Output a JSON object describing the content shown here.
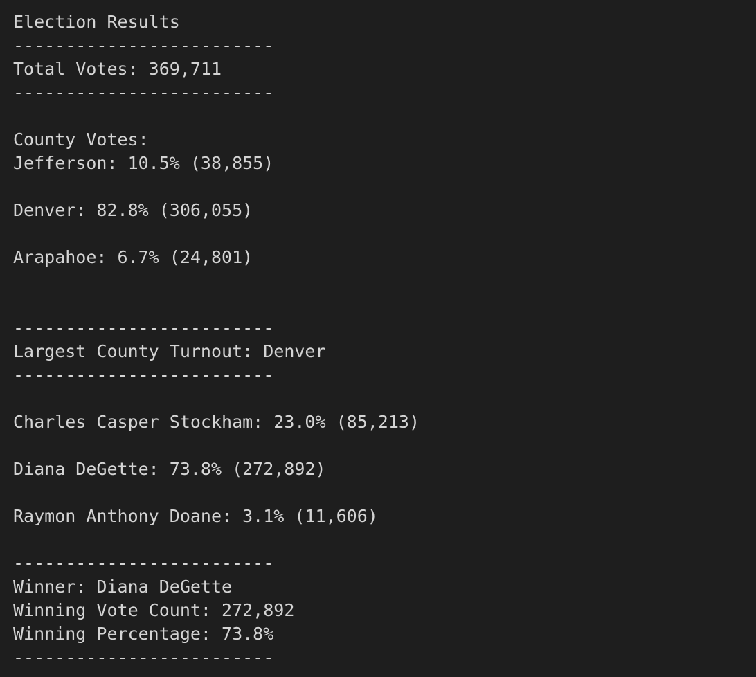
{
  "output": {
    "title": "Election Results",
    "separator": "-------------------------",
    "total_votes": "Total Votes: 369,711",
    "county_header": "County Votes:",
    "counties": [
      "Jefferson: 10.5% (38,855)",
      "Denver: 82.8% (306,055)",
      "Arapahoe: 6.7% (24,801)"
    ],
    "largest_county": "Largest County Turnout: Denver",
    "candidates": [
      "Charles Casper Stockham: 23.0% (85,213)",
      "Diana DeGette: 73.8% (272,892)",
      "Raymon Anthony Doane: 3.1% (11,606)"
    ],
    "winner": "Winner: Diana DeGette",
    "winning_vote_count": "Winning Vote Count: 272,892",
    "winning_percentage": "Winning Percentage: 73.8%"
  }
}
